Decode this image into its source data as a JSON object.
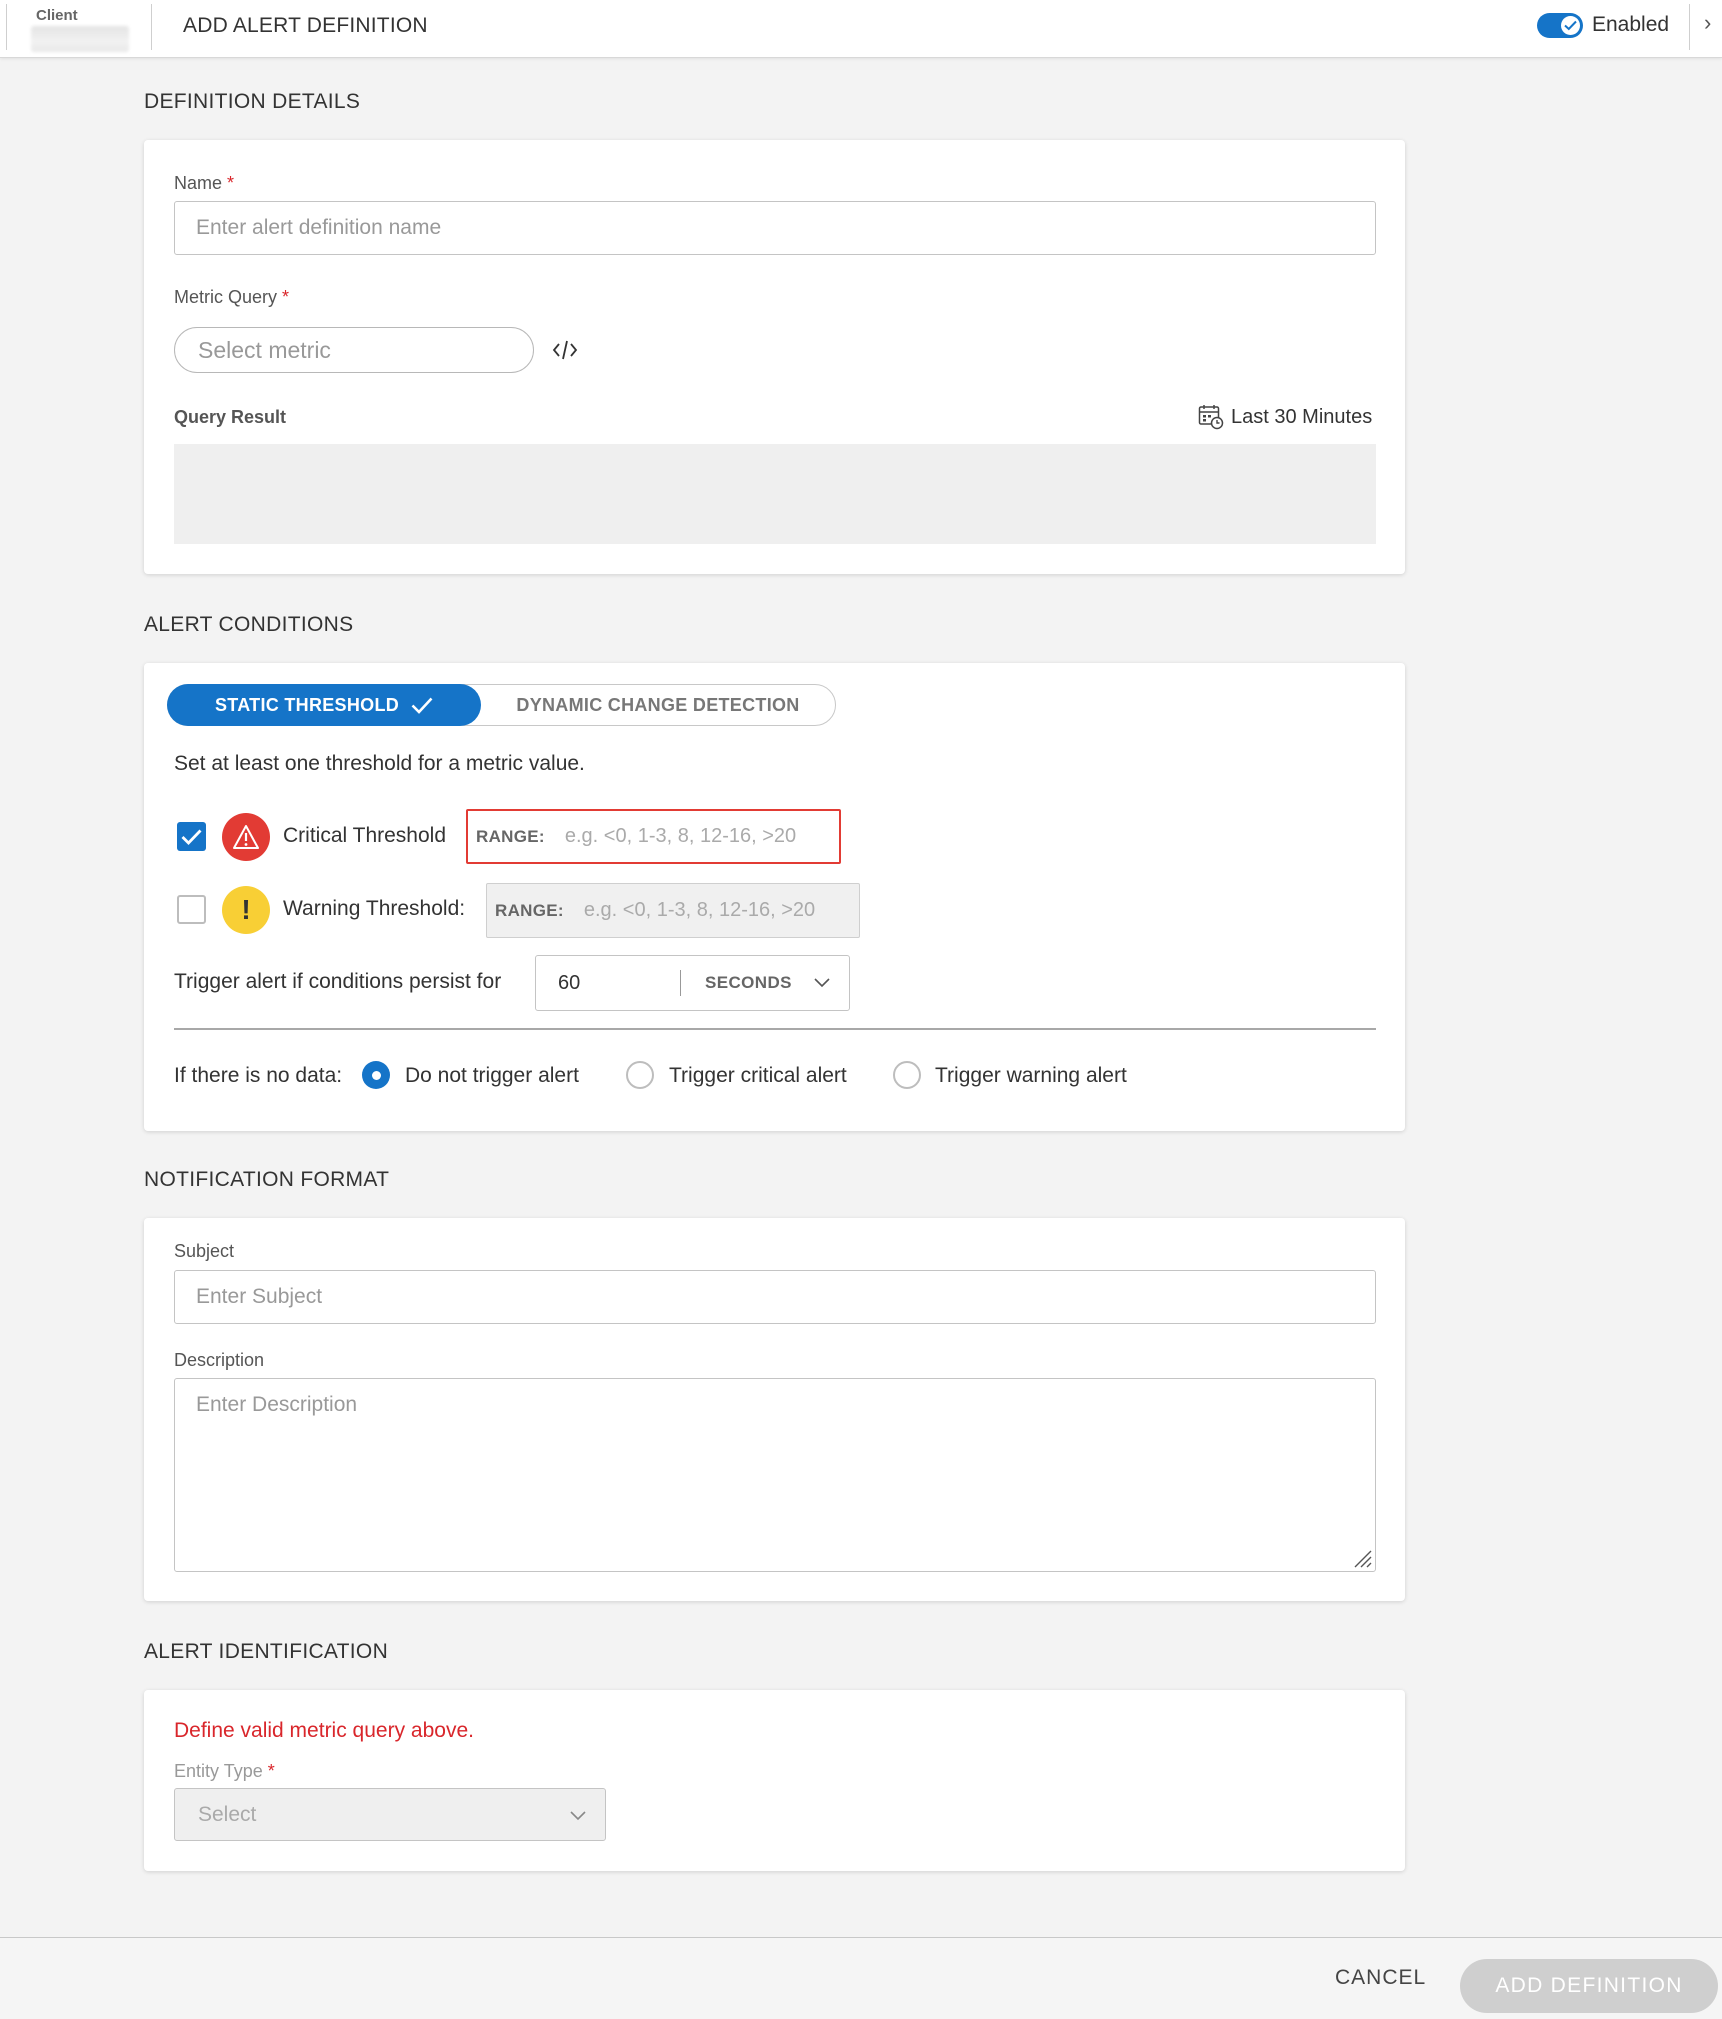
{
  "header": {
    "client_label": "Client",
    "title": "ADD ALERT DEFINITION",
    "enabled_label": "Enabled",
    "enabled": true,
    "collapse_glyph": "›",
    "accent_color": "#1574c8"
  },
  "definition_details": {
    "section_title": "DEFINITION DETAILS",
    "name_label": "Name",
    "required_mark": "*",
    "name_placeholder": "Enter alert definition name",
    "metric_query_label": "Metric Query",
    "metric_placeholder": "Select metric",
    "code_icon": "code-brackets-icon",
    "query_result_label": "Query Result",
    "time_range_icon": "calendar-clock-icon",
    "time_range": "Last 30 Minutes"
  },
  "alert_conditions": {
    "section_title": "ALERT CONDITIONS",
    "tabs": [
      {
        "label": "STATIC THRESHOLD",
        "active": true
      },
      {
        "label": "DYNAMIC CHANGE DETECTION",
        "active": false
      }
    ],
    "instructions": "Set at least one threshold for a metric value.",
    "critical": {
      "checked": true,
      "label": "Critical Threshold",
      "range_tag": "RANGE:",
      "range_placeholder": "e.g. <0, 1-3, 8, 12-16, >20",
      "color": "#e23b34"
    },
    "warning": {
      "checked": false,
      "label": "Warning Threshold:",
      "range_tag": "RANGE:",
      "range_placeholder": "e.g. <0, 1-3, 8, 12-16, >20",
      "icon_glyph": "!",
      "color": "#f8cf35"
    },
    "persist_label": "Trigger alert if conditions persist for",
    "persist_value": "60",
    "persist_unit": "SECONDS",
    "no_data_label": "If there is no data:",
    "no_data_options": [
      {
        "label": "Do not trigger alert",
        "selected": true
      },
      {
        "label": "Trigger critical alert",
        "selected": false
      },
      {
        "label": "Trigger warning alert",
        "selected": false
      }
    ]
  },
  "notification_format": {
    "section_title": "NOTIFICATION FORMAT",
    "subject_label": "Subject",
    "subject_placeholder": "Enter Subject",
    "description_label": "Description",
    "description_placeholder": "Enter Description"
  },
  "alert_identification": {
    "section_title": "ALERT IDENTIFICATION",
    "error": "Define valid metric query above.",
    "entity_type_label": "Entity Type",
    "entity_type_placeholder": "Select"
  },
  "footer": {
    "cancel_label": "CANCEL",
    "add_label": "ADD DEFINITION"
  }
}
